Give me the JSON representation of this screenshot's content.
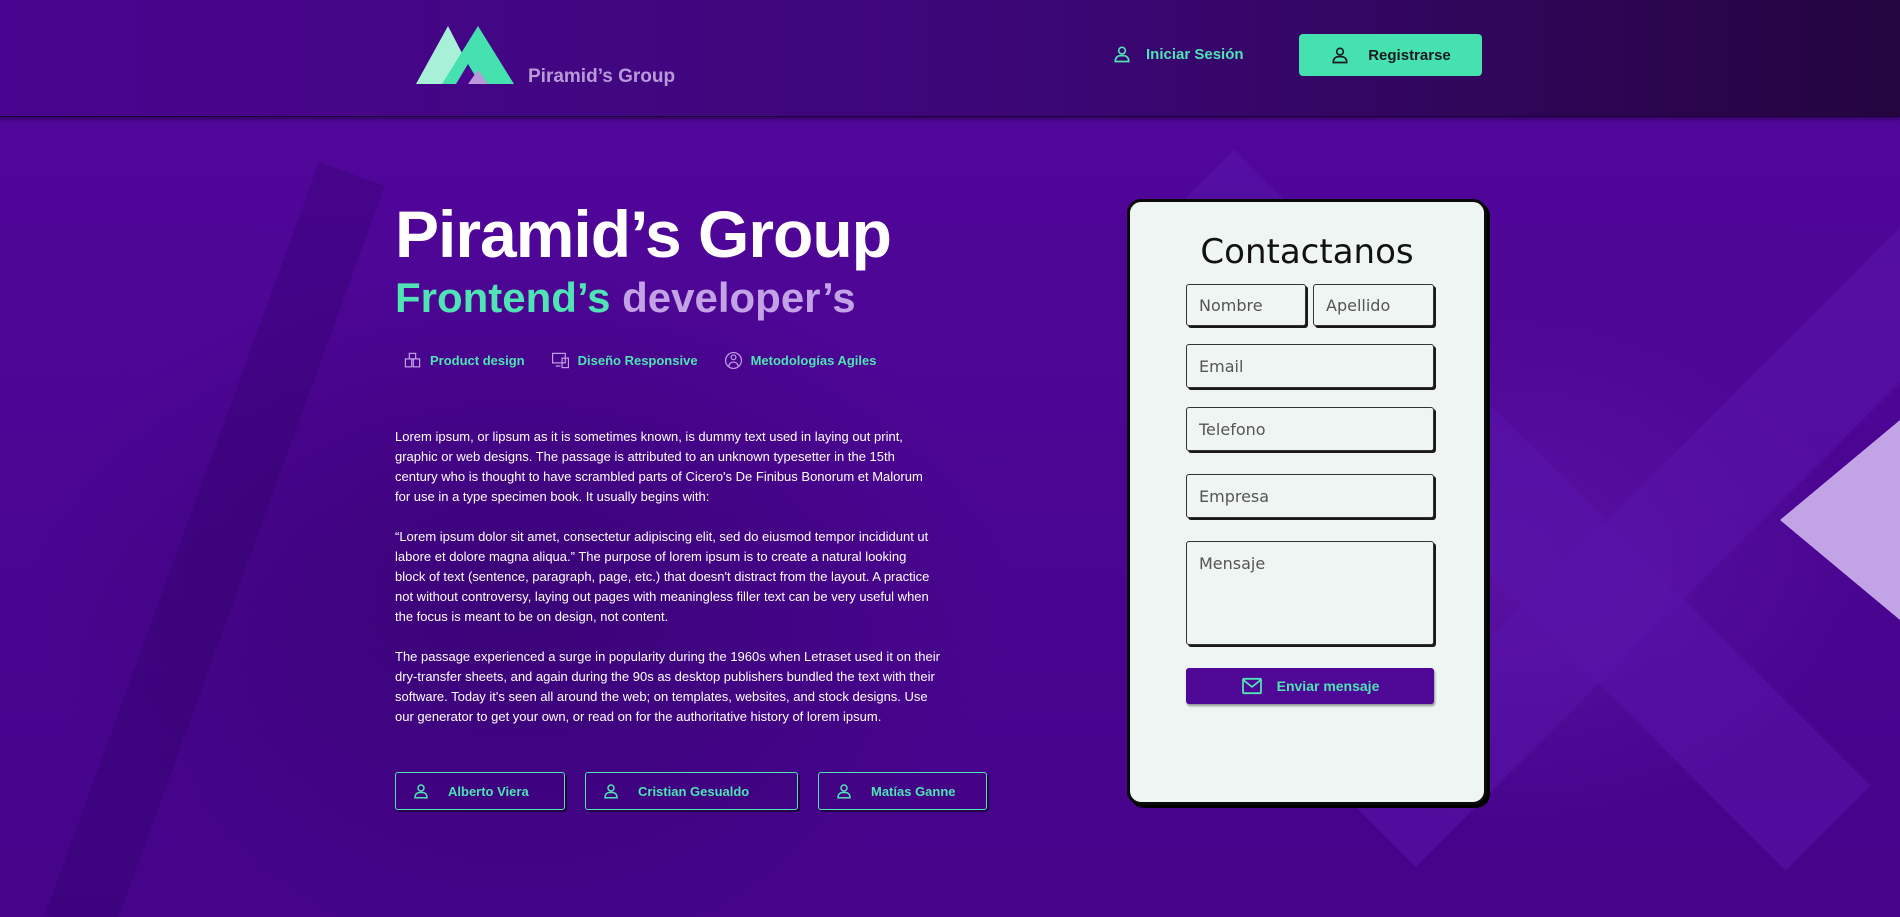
{
  "brand": {
    "name": "Piramid’s Group",
    "logo_icon": "mountain-logo",
    "colors": {
      "accent": "#45e2b0",
      "purple": "#4c0495",
      "lilac": "#c3a2e6"
    }
  },
  "nav": {
    "login_label": "Iniciar Sesión",
    "register_label": "Registrarse"
  },
  "hero": {
    "title": "Piramid’s Group",
    "subtitle_a": "Frontend’s",
    "subtitle_b": "developer’s",
    "skills": [
      {
        "icon": "product-design-icon",
        "label": "Product design"
      },
      {
        "icon": "responsive-design-icon",
        "label": "Diseño Responsive"
      },
      {
        "icon": "agile-methodologies-icon",
        "label": "Metodologías Agiles"
      }
    ],
    "paragraphs": [
      "Lorem ipsum, or lipsum as it is sometimes known, is dummy text used in laying out print, graphic or web designs. The passage is attributed to an unknown typesetter in the 15th century who is thought to have scrambled parts of Cicero's De Finibus Bonorum et Malorum for use in a type specimen book. It usually begins with:",
      "“Lorem ipsum dolor sit amet, consectetur adipiscing elit, sed do eiusmod tempor incididunt ut labore et dolore magna aliqua.” The purpose of lorem ipsum is to create a natural looking block of text (sentence, paragraph, page, etc.) that doesn't distract from the layout. A practice not without controversy, laying out pages with meaningless filler text can be very useful when the focus is meant to be on design, not content.",
      "The passage experienced a surge in popularity during the 1960s when Letraset used it on their dry-transfer sheets, and again during the 90s as desktop publishers bundled the text with their software. Today it's seen all around the web; on templates, websites, and stock designs. Use our generator to get your own, or read on for the authoritative history of lorem ipsum."
    ],
    "members": [
      "Alberto Viera",
      "Cristian Gesualdo",
      "Matías Ganne"
    ]
  },
  "contact": {
    "title": "Contactanos",
    "placeholders": {
      "nombre": "Nombre",
      "apellido": "Apellido",
      "email": "Email",
      "telefono": "Telefono",
      "empresa": "Empresa",
      "mensaje": "Mensaje"
    },
    "send_label": "Enviar mensaje"
  }
}
